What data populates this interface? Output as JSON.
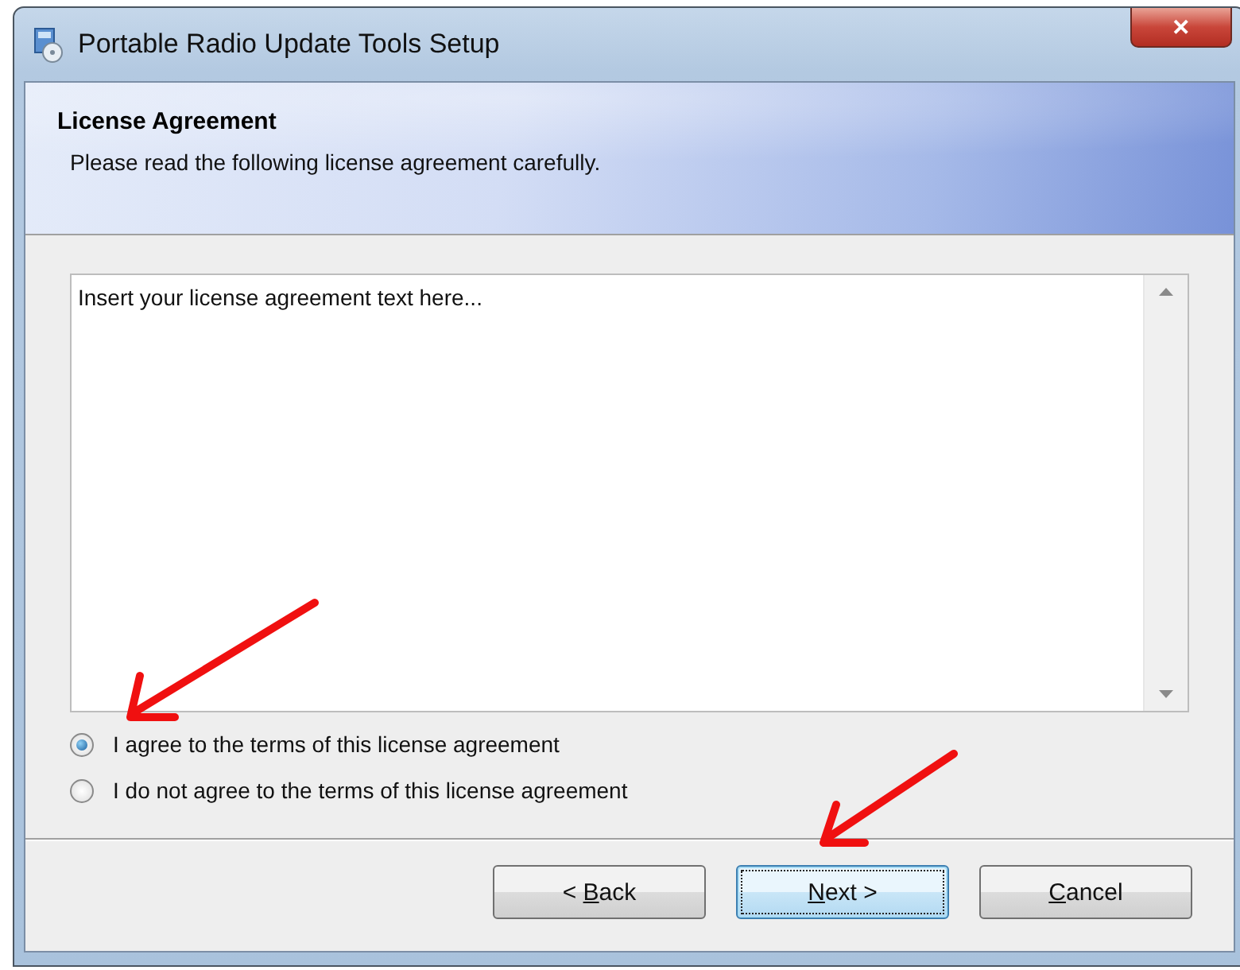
{
  "window": {
    "title": "Portable Radio Update Tools Setup",
    "close_glyph": "✕"
  },
  "header": {
    "title": "License Agreement",
    "subtitle": "Please read the following license agreement carefully."
  },
  "license_text": "Insert your license agreement text here...",
  "options": [
    {
      "label": "I agree to the terms of this license agreement",
      "selected": true
    },
    {
      "label": "I do not agree to the terms of this license agreement",
      "selected": false
    }
  ],
  "buttons": [
    {
      "prefix": "< ",
      "access_key": "B",
      "rest": "ack",
      "focused": false
    },
    {
      "access_key": "N",
      "rest": "ext >",
      "focused": true
    },
    {
      "access_key": "C",
      "rest": "ancel",
      "focused": false
    }
  ]
}
